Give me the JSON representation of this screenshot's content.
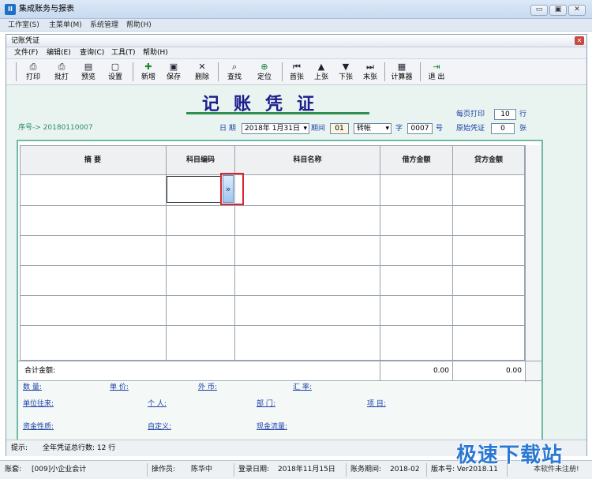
{
  "app": {
    "title": "集成账务与报表",
    "icon_text": "II"
  },
  "window_buttons": {
    "minimize": "▭",
    "maximize": "▣",
    "close": "✕"
  },
  "menu": [
    "工作室(S)",
    "主菜单(M)",
    "系统管理",
    "帮助(H)"
  ],
  "child_window": {
    "title": "记账凭证",
    "close": "✕"
  },
  "child_menu": [
    "文件(F)",
    "编辑(E)",
    "查询(C)",
    "工具(T)",
    "帮助(H)"
  ],
  "toolbar": [
    {
      "label": "打印",
      "icon": "printer-icon",
      "glyph": "⎙"
    },
    {
      "label": "批打",
      "icon": "batch-print-icon",
      "glyph": "⎙"
    },
    {
      "label": "预览",
      "icon": "preview-icon",
      "glyph": "▤"
    },
    {
      "label": "设置",
      "icon": "settings-icon",
      "glyph": "▢"
    },
    {
      "label": "新增",
      "icon": "add-icon",
      "glyph": "✚"
    },
    {
      "label": "保存",
      "icon": "save-icon",
      "glyph": "▣"
    },
    {
      "label": "删除",
      "icon": "delete-icon",
      "glyph": "✕"
    },
    {
      "label": "查找",
      "icon": "binoculars-icon",
      "glyph": "⌕"
    },
    {
      "label": "定位",
      "icon": "locate-icon",
      "glyph": "⊕"
    },
    {
      "label": "首张",
      "icon": "first-icon",
      "glyph": "⏮"
    },
    {
      "label": "上张",
      "icon": "previous-icon",
      "glyph": "▲"
    },
    {
      "label": "下张",
      "icon": "next-icon",
      "glyph": "▼"
    },
    {
      "label": "末张",
      "icon": "last-icon",
      "glyph": "⏭"
    },
    {
      "label": "计算器",
      "icon": "calculator-icon",
      "glyph": "▦"
    },
    {
      "label": "退 出",
      "icon": "exit-icon",
      "glyph": "⇥"
    }
  ],
  "voucher": {
    "title": "记账凭证",
    "serial_label": "序号-> 20180110007",
    "date_label": "日 期",
    "date_value": "2018年 1月31日",
    "period_label": "期间",
    "period_value": "01",
    "voucher_type": "转帐",
    "number_label": "字",
    "number_value": "0007",
    "number_suffix": "号",
    "per_page_label": "每页打印",
    "per_page_value": "10",
    "per_page_unit": "行",
    "original_label": "原始凭证",
    "original_value": "0",
    "original_unit": "张"
  },
  "table": {
    "headers": [
      "摘  要",
      "科目编码",
      "科目名称",
      "借方金额",
      "贷方金额"
    ],
    "expand_button": "»",
    "total_label": "合计金额:",
    "debit_total": "0.00",
    "credit_total": "0.00"
  },
  "aux": {
    "quantity": "数 量:",
    "unit_price": "单 价:",
    "foreign": "外 币:",
    "exchange": "汇 率:",
    "unit_account": "单位往来:",
    "person": "个  人:",
    "department": "部    门:",
    "project": "项    目:",
    "fund_nature": "资金性质:",
    "custom": "自定义:",
    "cash_flow": "现金流量:"
  },
  "tip": {
    "label": "提示:",
    "text": "全年凭证总行数: 12 行"
  },
  "status": {
    "account": "账套:",
    "account_value": "[009]小企业会计",
    "operator": "操作员:",
    "operator_value": "陈华中",
    "login": "登录日期:",
    "login_value": "2018年11月15日",
    "period": "账务期间:",
    "period_value": "2018-02",
    "version": "版本号: Ver2018.11",
    "unregistered": "本软件未注册!"
  },
  "watermark": "极速下载站"
}
